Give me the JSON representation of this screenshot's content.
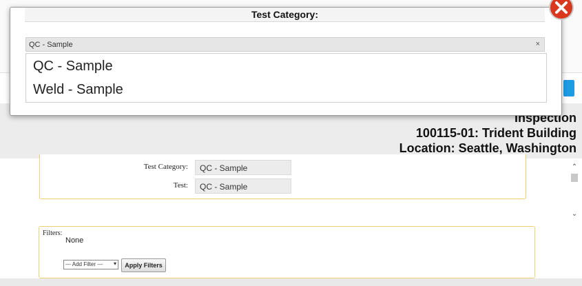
{
  "modal": {
    "title": "Test Category:",
    "selected": "QC - Sample",
    "clear_glyph": "×",
    "options": [
      "QC - Sample",
      "Weld - Sample"
    ],
    "close_icon": "close-x-icon",
    "close_color": "#d9381e"
  },
  "heading": {
    "line1": "Inspection",
    "line2": "100115-01: Trident Building",
    "line3": "Location: Seattle, Washington"
  },
  "info": {
    "test_category_label": "Test Category:",
    "test_category_value": "QC - Sample",
    "test_label": "Test:",
    "test_value": "QC - Sample"
  },
  "filters": {
    "label": "Filters:",
    "current": "None",
    "add_filter_option": "--- Add Filter ---",
    "apply_label": "Apply Filters"
  },
  "colors": {
    "accent_blue": "#1d9be3",
    "box_border": "#f1d074"
  }
}
